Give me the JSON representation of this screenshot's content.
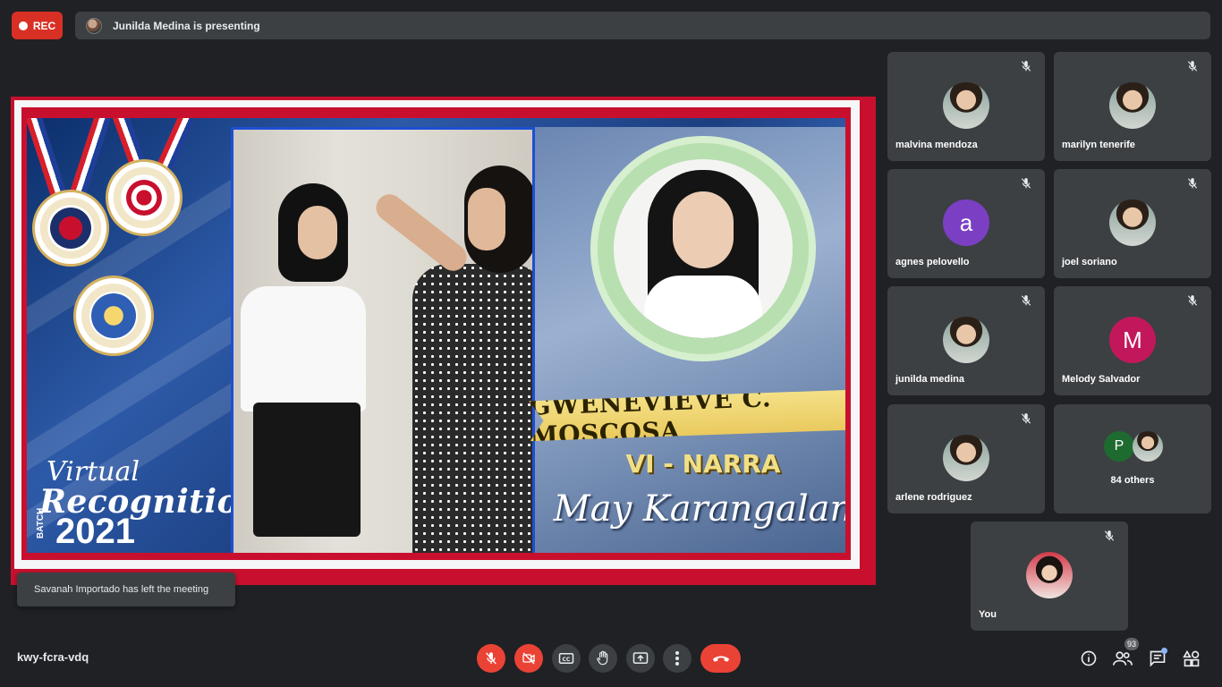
{
  "top_bar": {
    "rec_label": "REC",
    "presenting_text": "Junilda Medina is presenting"
  },
  "presentation": {
    "student_name": "GWENEVIEVE C. MOSCOSA",
    "section": "VI - NARRA",
    "honor": "May Karangalan",
    "title_small": "Virtual",
    "title_big": "Recognition",
    "batch_label": "BATCH",
    "year": "2021"
  },
  "toast": {
    "message": "Savanah Importado has left the meeting"
  },
  "participants": [
    {
      "name": "malvina mendoza",
      "avatar": "photo",
      "muted": true
    },
    {
      "name": "marilyn tenerife",
      "avatar": "photo",
      "muted": true
    },
    {
      "name": "agnes pelovello",
      "avatar": "letter",
      "letter": "a",
      "color": "#7b3fc4",
      "muted": true
    },
    {
      "name": "joel soriano",
      "avatar": "photo",
      "muted": true
    },
    {
      "name": "junilda medina",
      "avatar": "photo",
      "muted": true
    },
    {
      "name": "Melody Salvador",
      "avatar": "letter",
      "letter": "M",
      "color": "#c2185b",
      "muted": true
    },
    {
      "name": "arlene rodriguez",
      "avatar": "photo",
      "muted": true
    },
    {
      "name": "84 others",
      "avatar": "group",
      "letter": "P",
      "color": "#1e6b2f",
      "muted": false
    }
  ],
  "self_tile": {
    "name": "You",
    "muted": true
  },
  "bottom_bar": {
    "meeting_code": "kwy-fcra-vdq",
    "people_count": "93"
  },
  "colors": {
    "background": "#202124",
    "tile": "#3c4043",
    "danger": "#ea4335",
    "accent_dot": "#8ab4f8"
  },
  "icons": [
    "mic-off-icon",
    "camera-off-icon",
    "captions-icon",
    "raise-hand-icon",
    "present-icon",
    "more-icon",
    "end-call-icon",
    "info-icon",
    "people-icon",
    "chat-icon",
    "activities-icon"
  ]
}
